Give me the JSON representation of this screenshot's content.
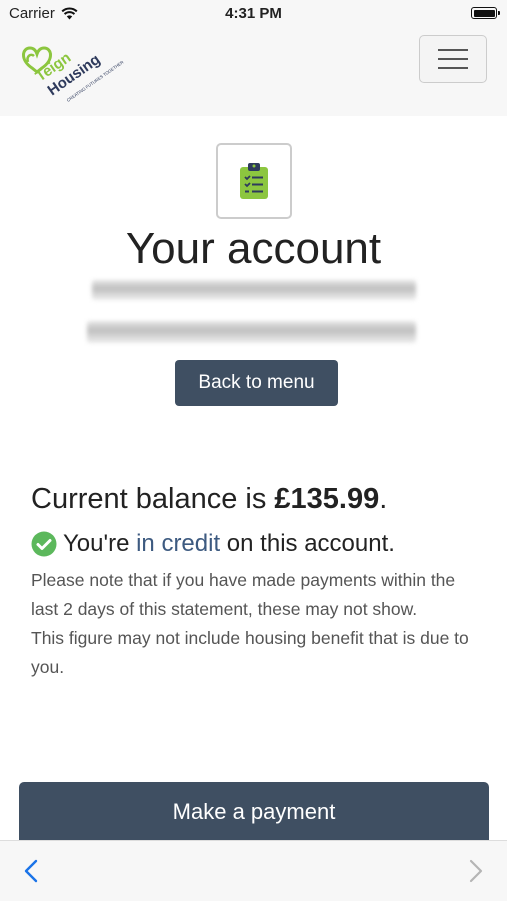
{
  "status_bar": {
    "carrier": "Carrier",
    "time": "4:31 PM"
  },
  "navbar": {
    "logo_text": "Teign Housing",
    "logo_tagline": "CREATING FUTURES TOGETHER",
    "brand_colors": {
      "green": "#8cc63f",
      "navy": "#2e3a5c"
    }
  },
  "header": {
    "icon": "clipboard-check-icon",
    "title": "Your account"
  },
  "back_button": {
    "label": "Back to menu"
  },
  "balance": {
    "prefix": "Current balance is ",
    "amount": "£135.99",
    "suffix": "."
  },
  "credit": {
    "pre": "You're ",
    "highlight": "in credit",
    "post": " on this account.",
    "icon": "check-circle-icon"
  },
  "notes": [
    "Please note that if you have made payments within the last 2 days of this statement, these may not show.",
    "This figure may not include housing benefit that is due to you."
  ],
  "pay_button": {
    "label": "Make a payment"
  },
  "colors": {
    "button": "#3f4f62",
    "accent_green": "#5cb85c",
    "link": "#3d5a80"
  }
}
